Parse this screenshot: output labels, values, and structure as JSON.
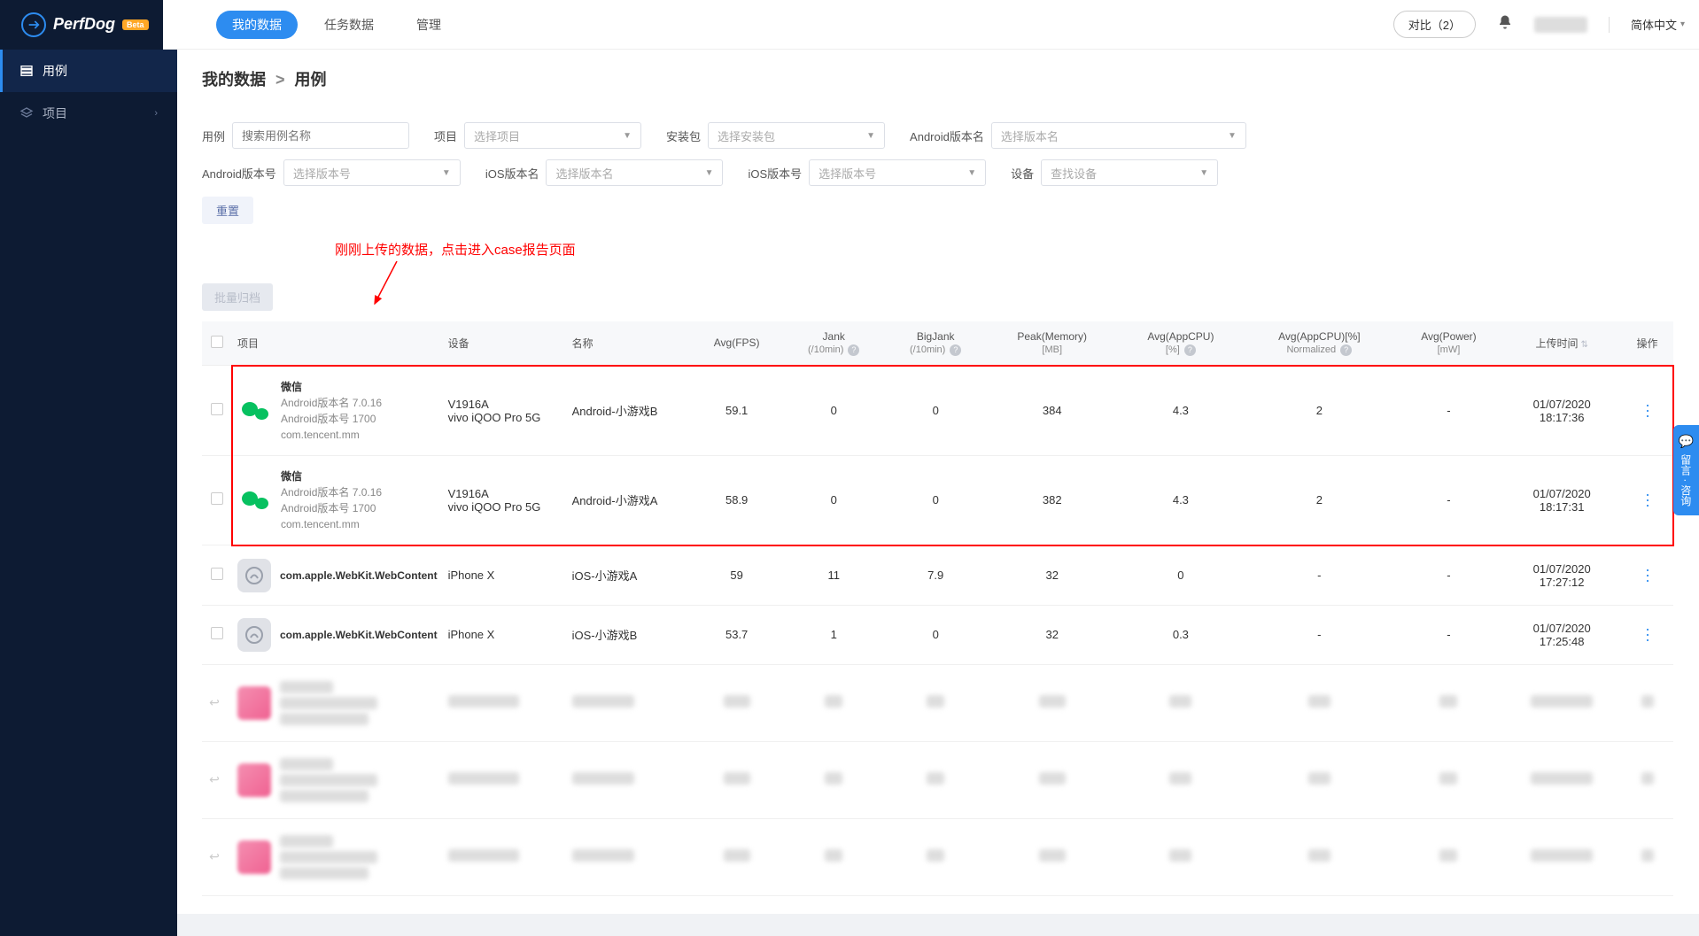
{
  "brand": {
    "name": "PerfDog",
    "badge": "Beta"
  },
  "topnav": {
    "items": [
      "我的数据",
      "任务数据",
      "管理"
    ],
    "active_index": 0
  },
  "top_right": {
    "compare": "对比（2）",
    "lang": "简体中文"
  },
  "sidebar": {
    "items": [
      {
        "label": "用例",
        "icon": "list"
      },
      {
        "label": "项目",
        "icon": "layers"
      }
    ],
    "active_index": 0
  },
  "breadcrumb": {
    "parent": "我的数据",
    "sep": ">",
    "current": "用例"
  },
  "filters": {
    "case_label": "用例",
    "case_placeholder": "搜索用例名称",
    "project_label": "项目",
    "project_placeholder": "选择项目",
    "package_label": "安装包",
    "package_placeholder": "选择安装包",
    "android_ver_name_label": "Android版本名",
    "android_ver_name_placeholder": "选择版本名",
    "android_ver_code_label": "Android版本号",
    "android_ver_code_placeholder": "选择版本号",
    "ios_ver_name_label": "iOS版本名",
    "ios_ver_name_placeholder": "选择版本名",
    "ios_ver_code_label": "iOS版本号",
    "ios_ver_code_placeholder": "选择版本号",
    "device_label": "设备",
    "device_placeholder": "查找设备",
    "reset": "重置"
  },
  "annotation": "刚刚上传的数据，点击进入case报告页面",
  "batch_button": "批量归档",
  "table": {
    "headers": {
      "project": "项目",
      "device": "设备",
      "name": "名称",
      "avg_fps": "Avg(FPS)",
      "jank": "Jank",
      "jank_sub": "(/10min)",
      "bigjank": "BigJank",
      "bigjank_sub": "(/10min)",
      "peak_mem": "Peak(Memory)",
      "peak_mem_sub": "[MB]",
      "avg_cpu": "Avg(AppCPU)",
      "avg_cpu_sub": "[%]",
      "avg_cpu_norm": "Avg(AppCPU)[%]",
      "avg_cpu_norm_sub": "Normalized",
      "avg_power": "Avg(Power)",
      "avg_power_sub": "[mW]",
      "upload_time": "上传时间",
      "action": "操作"
    },
    "rows": [
      {
        "highlight": true,
        "app_kind": "wechat",
        "proj_name": "微信",
        "proj_lines": [
          "Android版本名 7.0.16",
          "Android版本号 1700",
          "com.tencent.mm"
        ],
        "device_lines": [
          "V1916A",
          "vivo iQOO Pro 5G"
        ],
        "case_name": "Android-小游戏B",
        "avg_fps": "59.1",
        "jank": "0",
        "bigjank": "0",
        "peak_mem": "384",
        "avg_cpu": "4.3",
        "avg_cpu_norm": "2",
        "avg_power": "-",
        "upload_time": [
          "01/07/2020",
          "18:17:36"
        ]
      },
      {
        "highlight": true,
        "app_kind": "wechat",
        "proj_name": "微信",
        "proj_lines": [
          "Android版本名 7.0.16",
          "Android版本号 1700",
          "com.tencent.mm"
        ],
        "device_lines": [
          "V1916A",
          "vivo iQOO Pro 5G"
        ],
        "case_name": "Android-小游戏A",
        "avg_fps": "58.9",
        "jank": "0",
        "bigjank": "0",
        "peak_mem": "382",
        "avg_cpu": "4.3",
        "avg_cpu_norm": "2",
        "avg_power": "-",
        "upload_time": [
          "01/07/2020",
          "18:17:31"
        ]
      },
      {
        "highlight": false,
        "app_kind": "gray",
        "proj_name": "com.apple.WebKit.WebContent",
        "proj_lines": [],
        "device_lines": [
          "iPhone X"
        ],
        "case_name": "iOS-小游戏A",
        "avg_fps": "59",
        "jank": "11",
        "bigjank": "7.9",
        "peak_mem": "32",
        "avg_cpu": "0",
        "avg_cpu_norm": "-",
        "avg_power": "-",
        "upload_time": [
          "01/07/2020",
          "17:27:12"
        ]
      },
      {
        "highlight": false,
        "app_kind": "gray",
        "proj_name": "com.apple.WebKit.WebContent",
        "proj_lines": [],
        "device_lines": [
          "iPhone X"
        ],
        "case_name": "iOS-小游戏B",
        "avg_fps": "53.7",
        "jank": "1",
        "bigjank": "0",
        "peak_mem": "32",
        "avg_cpu": "0.3",
        "avg_cpu_norm": "-",
        "avg_power": "-",
        "upload_time": [
          "01/07/2020",
          "17:25:48"
        ]
      }
    ]
  },
  "feedback_tab": "留言 · 咨询"
}
